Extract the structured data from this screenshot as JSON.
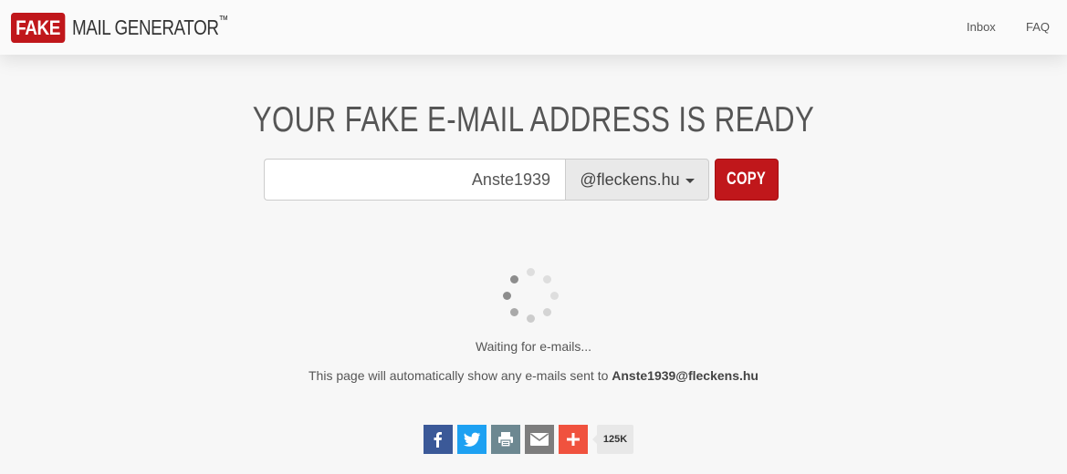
{
  "navbar": {
    "logo_fake": "FAKE",
    "logo_rest": "MAIL GENERATOR",
    "logo_tm": "™",
    "links": [
      {
        "label": "Inbox"
      },
      {
        "label": "FAQ"
      }
    ]
  },
  "hero": {
    "title": "YOUR FAKE E-MAIL ADDRESS IS READY",
    "username_value": "Anste1939",
    "domain_value": "@fleckens.hu",
    "copy_label": "COPY"
  },
  "status": {
    "waiting_text": "Waiting for e-mails...",
    "info_prefix": "This page will automatically show any e-mails sent to",
    "info_address": "Anste1939@fleckens.hu"
  },
  "share": {
    "buttons": [
      {
        "icon": "facebook-icon",
        "color": "#3b5998"
      },
      {
        "icon": "twitter-icon",
        "color": "#1da1f2"
      },
      {
        "icon": "print-icon",
        "color": "#6d8891"
      },
      {
        "icon": "email-icon",
        "color": "#7d7d7d"
      },
      {
        "icon": "plus-icon",
        "color": "#f0523e"
      }
    ],
    "count": "125K"
  },
  "colors": {
    "brand_red": "#c0171b",
    "background": "#f7f7f7",
    "text": "#555555"
  }
}
